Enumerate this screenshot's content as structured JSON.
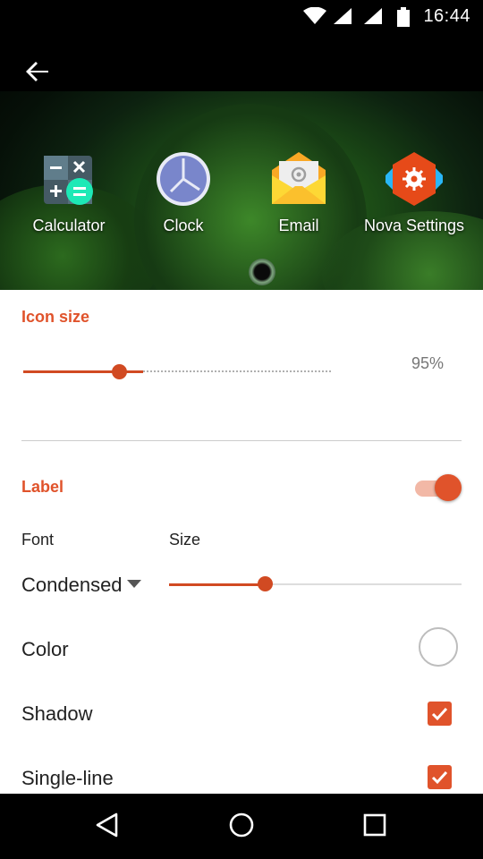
{
  "status_bar": {
    "time": "16:44",
    "icons": [
      "wifi-icon",
      "cell-signal-icon",
      "cell-signal-icon",
      "battery-icon"
    ]
  },
  "header": {
    "back_icon": "arrow-back-icon"
  },
  "preview_apps": [
    {
      "name": "Calculator",
      "icon": "calculator-icon"
    },
    {
      "name": "Clock",
      "icon": "clock-icon"
    },
    {
      "name": "Email",
      "icon": "email-icon"
    },
    {
      "name": "Nova Settings",
      "icon": "nova-settings-icon"
    }
  ],
  "icon_size": {
    "title": "Icon size",
    "value_text": "95%",
    "slider_fraction": 0.32
  },
  "label": {
    "title": "Label",
    "enabled": true,
    "font_label": "Font",
    "size_label": "Size",
    "font_value": "Condensed",
    "size_slider_fraction": 0.33
  },
  "options": [
    {
      "label": "Color",
      "control": "color-picker"
    },
    {
      "label": "Shadow",
      "control": "checkbox",
      "checked": true
    },
    {
      "label": "Single-line",
      "control": "checkbox",
      "checked": true
    }
  ],
  "colors": {
    "accent": "#e0532b",
    "accent_dark": "#d14a22",
    "toggle_track": "#f2b8a6"
  },
  "nav_bar": {
    "icons": [
      "back-triangle-icon",
      "home-circle-icon",
      "recents-square-icon"
    ]
  }
}
